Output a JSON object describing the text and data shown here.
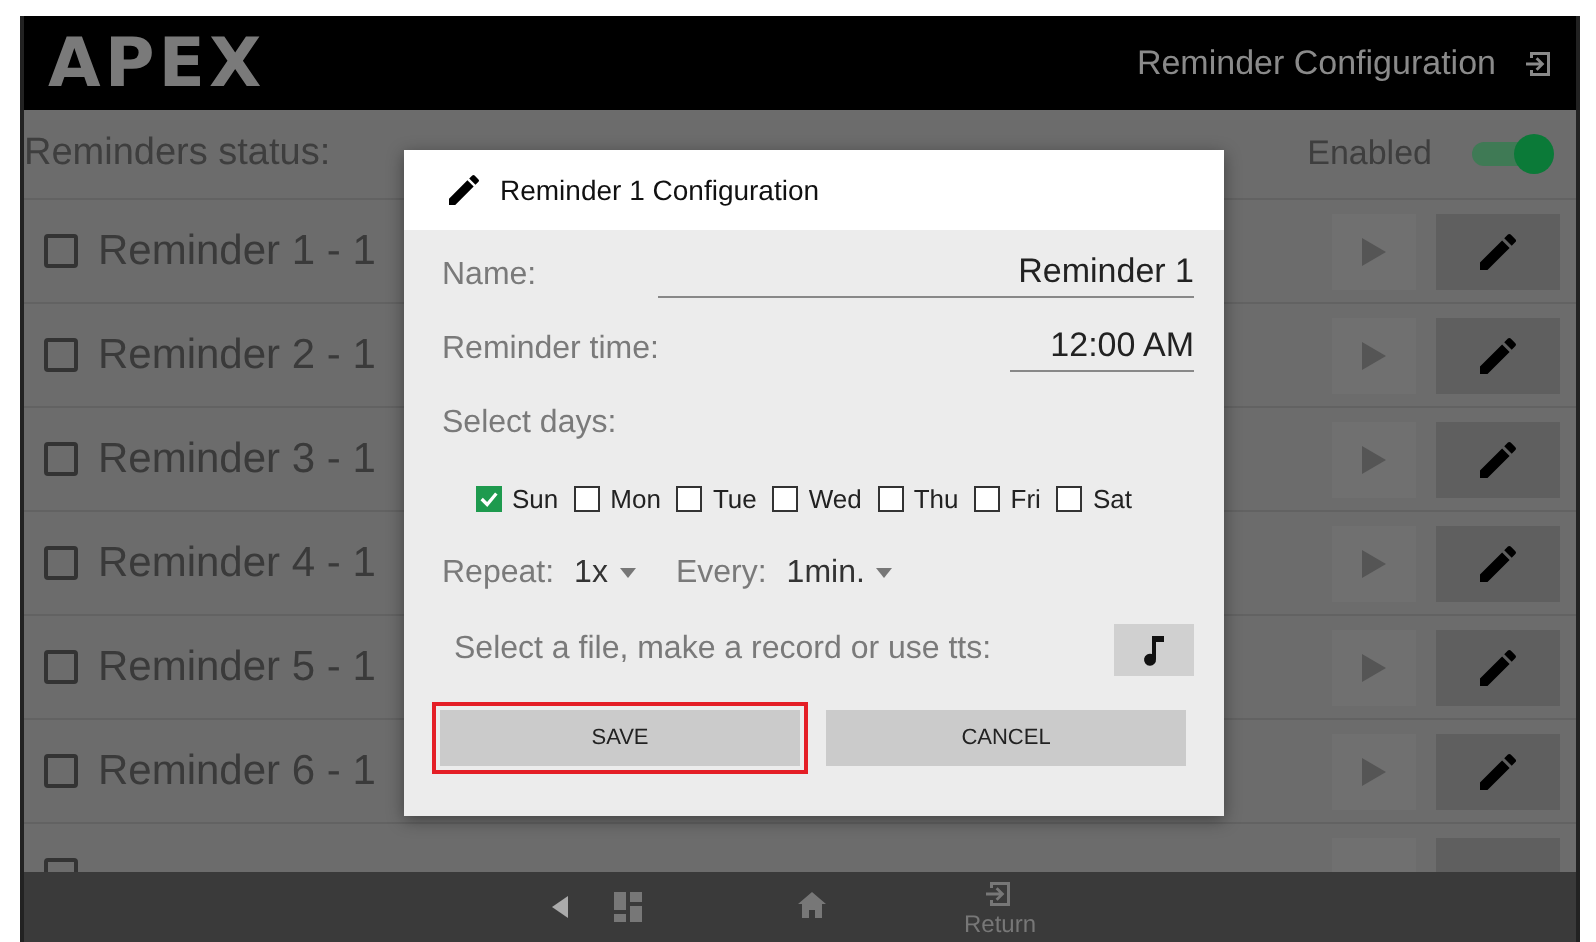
{
  "header": {
    "logo": "APEX",
    "title": "Reminder Configuration"
  },
  "status": {
    "label": "Reminders status:",
    "state_label": "Enabled",
    "on": true
  },
  "reminders": [
    {
      "label": "Reminder 1 - 1",
      "checked": false
    },
    {
      "label": "Reminder 2 - 1",
      "checked": false
    },
    {
      "label": "Reminder 3 - 1",
      "checked": false
    },
    {
      "label": "Reminder 4 - 1",
      "checked": false
    },
    {
      "label": "Reminder 5 - 1",
      "checked": false
    },
    {
      "label": "Reminder 6 - 1",
      "checked": false
    },
    {
      "checked": false
    }
  ],
  "dialog": {
    "title": "Reminder 1 Configuration",
    "name_label": "Name:",
    "name_value": "Reminder 1",
    "time_label": "Reminder time:",
    "time_value": "12:00 AM",
    "days_label": "Select days:",
    "days": [
      {
        "label": "Sun",
        "checked": true
      },
      {
        "label": "Mon",
        "checked": false
      },
      {
        "label": "Tue",
        "checked": false
      },
      {
        "label": "Wed",
        "checked": false
      },
      {
        "label": "Thu",
        "checked": false
      },
      {
        "label": "Fri",
        "checked": false
      },
      {
        "label": "Sat",
        "checked": false
      }
    ],
    "repeat_label": "Repeat:",
    "repeat_value": "1x",
    "every_label": "Every:",
    "every_value": "1min.",
    "file_label": "Select a file, make a record or use tts:",
    "buttons": [
      {
        "label": "SAVE",
        "highlighted": true
      },
      {
        "label": "CANCEL",
        "highlighted": false
      }
    ]
  },
  "nav": {
    "return_label": "Return"
  }
}
